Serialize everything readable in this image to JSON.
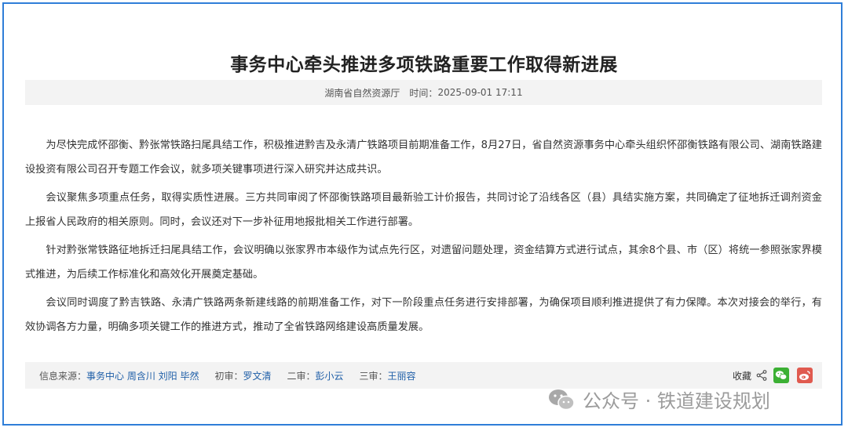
{
  "article": {
    "title": "事务中心牵头推进多项铁路重要工作取得新进展",
    "source_org": "湖南省自然资源厅",
    "time_label": "时间：",
    "time_value": "2025-09-01 17:11",
    "paragraphs": [
      "为尽快完成怀邵衡、黔张常铁路扫尾具结工作，积极推进黔吉及永清广铁路项目前期准备工作，8月27日，省自然资源事务中心牵头组织怀邵衡铁路有限公司、湖南铁路建设投资有限公司召开专题工作会议，就多项关键事项进行深入研究并达成共识。",
      "会议聚焦多项重点任务，取得实质性进展。三方共同审阅了怀邵衡铁路项目最新验工计价报告，共同讨论了沿线各区（县）具结实施方案，共同确定了征地拆迁调剂资金上报省人民政府的相关原则。同时，会议还对下一步补征用地报批相关工作进行部署。",
      "针对黔张常铁路征地拆迁扫尾具结工作，会议明确以张家界市本级作为试点先行区，对遗留问题处理，资金结算方式进行试点，其余8个县、市（区）将统一参照张家界模式推进，为后续工作标准化和高效化开展奠定基础。",
      "会议同时调度了黔吉铁路、永清广铁路两条新建线路的前期准备工作，对下一阶段重点任务进行安排部署，为确保项目顺利推进提供了有力保障。本次对接会的举行，有效协调各方力量，明确多项关键工作的推进方式，推动了全省铁路网络建设高质量发展。"
    ]
  },
  "footer": {
    "source_label": "信息来源：",
    "source_value": "事务中心 周含川 刘阳 毕然",
    "first_review_label": "初审：",
    "first_review_value": "罗文清",
    "second_review_label": "二审：",
    "second_review_value": "彭小云",
    "third_review_label": "三审：",
    "third_review_value": "王丽容",
    "collect_label": "收藏"
  },
  "watermark": {
    "text": "公众号 · 铁道建设规划"
  },
  "colors": {
    "frame": "#2f7ed8",
    "link": "#1f5fa8",
    "wechat": "#3cb034",
    "weibo": "#e05a4f"
  },
  "icons": [
    "share-icon",
    "wechat-icon",
    "weibo-icon",
    "wechat-logo-icon"
  ]
}
